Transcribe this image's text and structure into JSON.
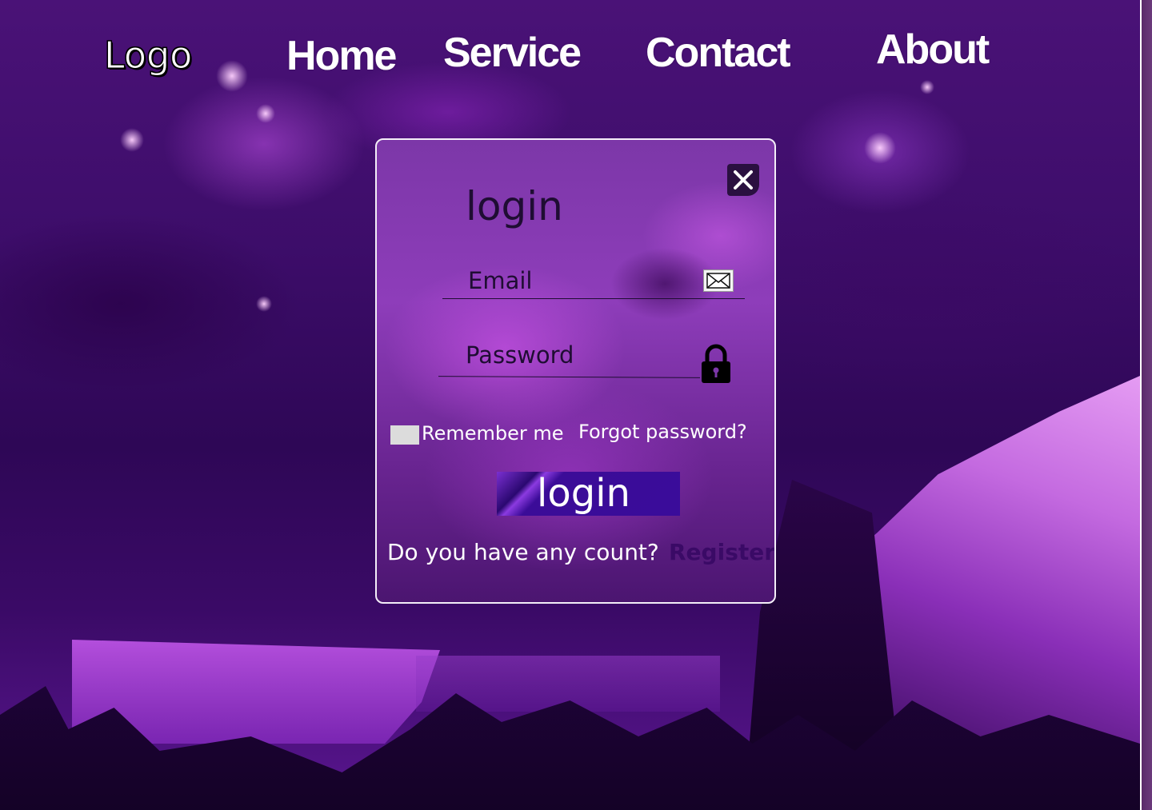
{
  "header": {
    "logo": "Logo",
    "nav": [
      {
        "label": "Home"
      },
      {
        "label": "Service"
      },
      {
        "label": "Contact"
      },
      {
        "label": "About"
      }
    ]
  },
  "login_card": {
    "title": "login",
    "email_label": "Email",
    "password_label": "Password",
    "remember_label": "Remember me",
    "forgot_label": "Forgot password?",
    "submit_label": "login",
    "account_prompt": "Do you have any count?",
    "register_label": "Register",
    "icons": {
      "close": "close-icon",
      "email": "mail-icon",
      "password": "lock-icon"
    }
  },
  "colors": {
    "background": "#3a0e63",
    "card_border": "#f4eef8",
    "button": "#3a0c9a",
    "register_link": "#3a0a66"
  }
}
